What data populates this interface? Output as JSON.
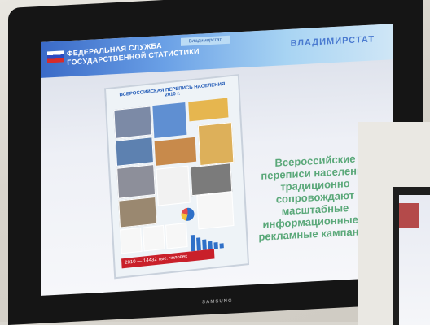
{
  "header": {
    "org_name_line1": "ФЕДЕРАЛЬНАЯ СЛУЖБА",
    "org_name_line2": "ГОСУДАРСТВЕННОЙ СТАТИСТИКИ",
    "city_tag": "Владимирстат",
    "city": "ВЛАДИМИРСТАТ"
  },
  "poster": {
    "title": "ВСЕРОССИЙСКАЯ ПЕРЕПИСЬ НАСЕЛЕНИЯ 2010 г.",
    "bottom": "2010 — 14432 тыс. человек"
  },
  "main_text": "Всероссийские переписи населения традиционно сопровождают масштабные информационные и рекламные кампании",
  "monitor_brand": "SAMSUNG"
}
